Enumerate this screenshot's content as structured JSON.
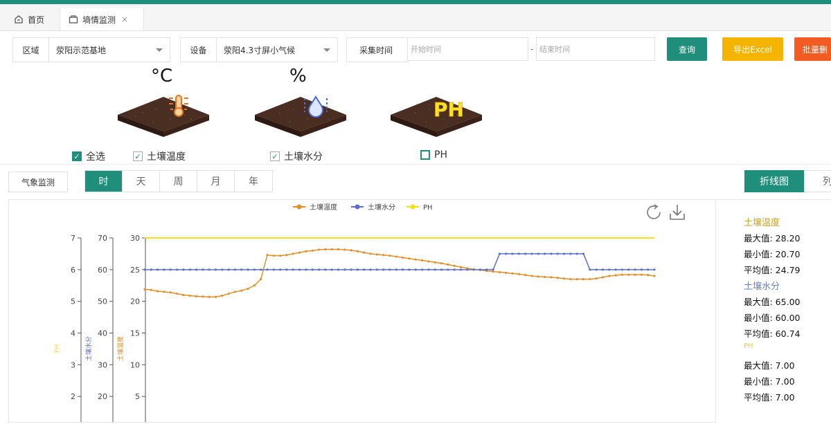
{
  "tabs": {
    "home": "首页",
    "active": "墒情监测",
    "close": "×"
  },
  "filters": {
    "region_label": "区域",
    "region_value": "荥阳示范基地",
    "device_label": "设备",
    "device_value": "荥阳4.3寸屏小气候",
    "time_label": "采集时间",
    "start_placeholder": "开始时间",
    "end_placeholder": "结束时间",
    "separator": "-"
  },
  "buttons": {
    "query": "查询",
    "export": "导出Excel",
    "batch": "批量删"
  },
  "sensors": [
    {
      "unit": "°C",
      "label": "土壤温度",
      "checked": true
    },
    {
      "unit": "%",
      "label": "土壤水分",
      "checked": true
    },
    {
      "unit": "",
      "badge": "PH",
      "label": "PH",
      "checked": false
    }
  ],
  "select_all": "全选",
  "weather_button": "气象监测",
  "periods": [
    "时",
    "天",
    "周",
    "月",
    "年"
  ],
  "chart_modes": {
    "line": "折线图",
    "other": "列"
  },
  "colors": {
    "accent": "#1f8f7c",
    "export": "#f5b400",
    "batch": "#f25c22",
    "temp": "#e0902a",
    "moisture": "#5b6fc9",
    "ph": "#f0e020"
  },
  "chart_data": {
    "type": "line",
    "legend": [
      "土壤温度",
      "土壤水分",
      "PH"
    ],
    "axes": [
      {
        "name": "PH",
        "ticks": [
          "7",
          "6",
          "5",
          "4",
          "3",
          "2"
        ],
        "range": [
          1,
          7
        ]
      },
      {
        "name": "土壤水分",
        "ticks": [
          "70",
          "60",
          "50",
          "40",
          "30",
          "20"
        ],
        "range": [
          10,
          70
        ]
      },
      {
        "name": "土壤温度",
        "ticks": [
          "30",
          "25",
          "20",
          "15",
          "10",
          "5"
        ],
        "range": [
          0,
          30
        ]
      }
    ],
    "x_count": 60,
    "series": [
      {
        "name": "土壤温度",
        "axis": 2,
        "values": [
          21.9,
          21.8,
          21.6,
          21.5,
          21.4,
          21.2,
          21.0,
          20.9,
          20.8,
          20.75,
          20.7,
          20.7,
          20.9,
          21.2,
          21.5,
          21.7,
          22.0,
          22.5,
          23.5,
          27.3,
          27.2,
          27.2,
          27.3,
          27.5,
          27.7,
          27.9,
          28.0,
          28.15,
          28.2,
          28.2,
          28.2,
          28.15,
          28.05,
          27.9,
          27.7,
          27.5,
          27.4,
          27.3,
          27.2,
          27.05,
          26.9,
          26.75,
          26.6,
          26.45,
          26.3,
          26.15,
          26.0,
          25.8,
          25.6,
          25.4,
          25.2,
          25.05,
          24.95,
          24.8,
          24.7,
          24.6,
          24.5,
          24.4,
          24.3,
          24.15,
          24.0,
          23.9,
          23.85,
          23.8,
          23.7,
          23.6,
          23.5,
          23.5,
          23.5,
          23.5,
          23.6,
          23.8,
          24.0,
          24.1,
          24.2,
          24.2,
          24.2,
          24.2,
          24.15,
          24.0
        ]
      },
      {
        "name": "土壤水分",
        "axis": 1,
        "values": [
          60,
          60,
          60,
          60,
          60,
          60,
          60,
          60,
          60,
          60,
          60,
          60,
          60,
          60,
          60,
          60,
          60,
          60,
          60,
          60,
          60,
          60,
          60,
          60,
          60,
          60,
          60,
          60,
          60,
          60,
          60,
          60,
          60,
          60,
          60,
          60,
          60,
          60,
          60,
          60,
          60,
          60,
          60,
          60,
          60,
          60,
          60,
          60,
          60,
          60,
          60,
          60,
          60,
          60,
          60,
          65,
          65,
          65,
          65,
          65,
          65,
          65,
          65,
          65,
          65,
          65,
          65,
          65,
          65,
          60,
          60,
          60,
          60,
          60,
          60,
          60,
          60,
          60,
          60,
          60
        ]
      },
      {
        "name": "PH",
        "axis": 0,
        "values": [
          7,
          7
        ]
      }
    ]
  },
  "stats": [
    {
      "title": "土壤温度",
      "color": "#c8a020",
      "rows": [
        "最大值: 28.20",
        "最小值: 20.70",
        "平均值: 24.79"
      ]
    },
    {
      "title": "土壤水分",
      "color": "#6b7fb8",
      "rows": [
        "最大值: 65.00",
        "最小值: 60.00",
        "平均值: 60.74"
      ]
    },
    {
      "title": "PH",
      "color": "#e8d820",
      "rows": [
        "最大值: 7.00",
        "最小值: 7.00",
        "平均值: 7.00"
      ]
    }
  ]
}
